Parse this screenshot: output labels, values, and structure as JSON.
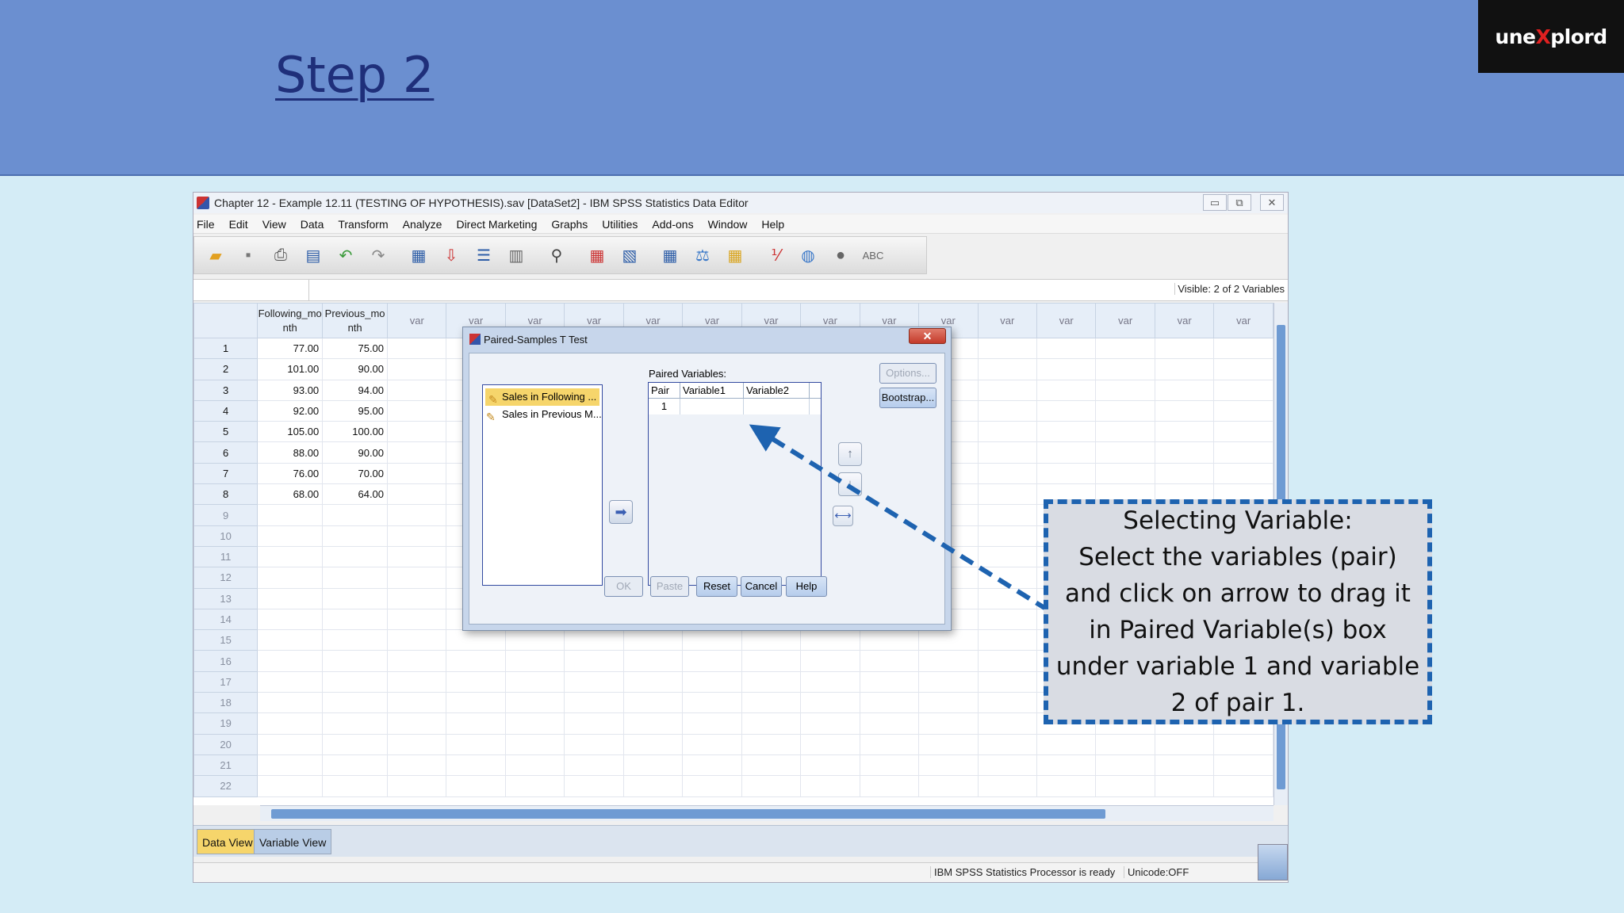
{
  "slide": {
    "title": "Step 2",
    "brand": {
      "pre": "une",
      "x": "X",
      "post": "plord"
    }
  },
  "window": {
    "title": "Chapter 12 - Example 12.11 (TESTING OF HYPOTHESIS).sav [DataSet2] - IBM SPSS Statistics Data Editor",
    "controls": [
      "▭",
      "⧉",
      "✕"
    ],
    "menu": [
      "File",
      "Edit",
      "View",
      "Data",
      "Transform",
      "Analyze",
      "Direct Marketing",
      "Graphs",
      "Utilities",
      "Add-ons",
      "Window",
      "Help"
    ],
    "toolbar_icons": [
      "open-folder-icon",
      "save-icon",
      "print-icon",
      "dialog-recall-icon",
      "undo-icon",
      "redo-icon",
      "goto-case-icon",
      "goto-variable-icon",
      "variables-icon",
      "run-icon",
      "find-icon",
      "insert-cases-icon",
      "insert-variable-icon",
      "split-file-icon",
      "weight-cases-icon",
      "select-cases-icon",
      "value-labels-icon",
      "use-sets-icon",
      "show-all-icon",
      "spell-check-icon"
    ],
    "visible_vars": "Visible: 2 of 2 Variables"
  },
  "sheet": {
    "headers": [
      "Following_mo nth",
      "Previous_mo nth",
      "var",
      "var",
      "var",
      "var",
      "var",
      "var",
      "var",
      "var",
      "var",
      "var",
      "var",
      "var",
      "var",
      "var",
      "var"
    ],
    "rows": [
      [
        "77.00",
        "75.00"
      ],
      [
        "101.00",
        "90.00"
      ],
      [
        "93.00",
        "94.00"
      ],
      [
        "92.00",
        "95.00"
      ],
      [
        "105.00",
        "100.00"
      ],
      [
        "88.00",
        "90.00"
      ],
      [
        "76.00",
        "70.00"
      ],
      [
        "68.00",
        "64.00"
      ]
    ],
    "row_count": 22
  },
  "tabs": {
    "data_view": "Data View",
    "variable_view": "Variable View"
  },
  "status": {
    "ready": "IBM SPSS Statistics Processor is ready",
    "unicode": "Unicode:OFF"
  },
  "dialog": {
    "title": "Paired-Samples T Test",
    "close": "✕",
    "source_items": [
      "Sales in Following ...",
      "Sales in Previous M..."
    ],
    "paired_label": "Paired Variables:",
    "pair_headers": [
      "Pair",
      "Variable1",
      "Variable2"
    ],
    "pair_row": [
      "1",
      "",
      ""
    ],
    "buttons": {
      "options": "Options...",
      "bootstrap": "Bootstrap...",
      "ok": "OK",
      "paste": "Paste",
      "reset": "Reset",
      "cancel": "Cancel",
      "help": "Help"
    }
  },
  "callout": {
    "lines": [
      "Selecting Variable:",
      "Select the variables (pair)",
      "and click on arrow to drag it",
      "in Paired Variable(s) box",
      "under variable 1 and variable",
      "2 of pair 1."
    ]
  },
  "colors": {
    "header_bg": "#6b8fd0",
    "accent": "#1e63b0",
    "selection": "#f6d56b"
  }
}
